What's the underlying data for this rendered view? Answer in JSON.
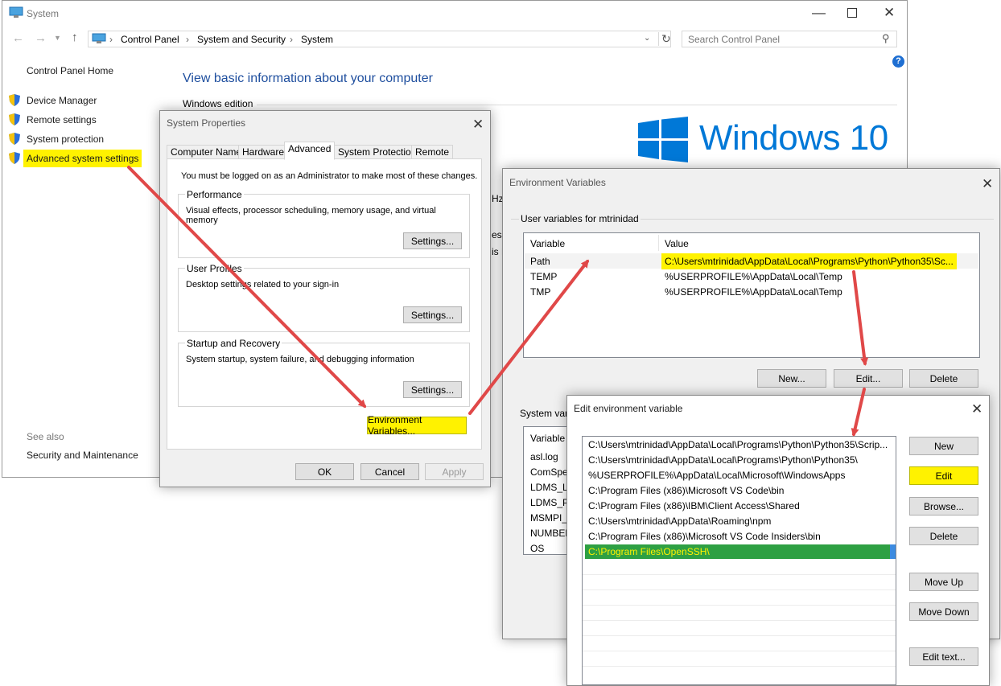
{
  "system_window": {
    "title": "System",
    "address": {
      "crumbs": [
        "Control Panel",
        "System and Security",
        "System"
      ],
      "search_placeholder": "Search Control Panel"
    },
    "sidebar": {
      "home": "Control Panel Home",
      "items": [
        {
          "label": "Device Manager"
        },
        {
          "label": "Remote settings"
        },
        {
          "label": "System protection"
        },
        {
          "label": "Advanced system settings"
        }
      ],
      "see_also": "See also",
      "security": "Security and Maintenance"
    },
    "heading": "View basic information about your computer",
    "windows_edition": "Windows edition",
    "logo_text": "Windows 10",
    "partial_text": [
      "Hz",
      "ess",
      "is D"
    ]
  },
  "system_properties": {
    "title": "System Properties",
    "tabs": [
      "Computer Name",
      "Hardware",
      "Advanced",
      "System Protection",
      "Remote"
    ],
    "admin_note": "You must be logged on as an Administrator to make most of these changes.",
    "performance": {
      "label": "Performance",
      "desc": "Visual effects, processor scheduling, memory usage, and virtual memory",
      "button": "Settings..."
    },
    "user_profiles": {
      "label": "User Profiles",
      "desc": "Desktop settings related to your sign-in",
      "button": "Settings..."
    },
    "startup": {
      "label": "Startup and Recovery",
      "desc": "System startup, system failure, and debugging information",
      "button": "Settings..."
    },
    "env_button": "Environment Variables...",
    "ok": "OK",
    "cancel": "Cancel",
    "apply": "Apply"
  },
  "env_vars": {
    "title": "Environment Variables",
    "user_label": "User variables for mtrinidad",
    "col_variable": "Variable",
    "col_value": "Value",
    "user_rows": [
      {
        "name": "Path",
        "value": "C:\\Users\\mtrinidad\\AppData\\Local\\Programs\\Python\\Python35\\Sc..."
      },
      {
        "name": "TEMP",
        "value": "%USERPROFILE%\\AppData\\Local\\Temp"
      },
      {
        "name": "TMP",
        "value": "%USERPROFILE%\\AppData\\Local\\Temp"
      }
    ],
    "new": "New...",
    "edit": "Edit...",
    "delete": "Delete",
    "system_label": "System vari",
    "sys_col_variable": "Variable",
    "system_rows": [
      "asl.log",
      "ComSpe",
      "LDMS_LO",
      "LDMS_PI",
      "MSMPI_I",
      "NUMBER",
      "OS"
    ]
  },
  "edit_env": {
    "title": "Edit environment variable",
    "entries": [
      "C:\\Users\\mtrinidad\\AppData\\Local\\Programs\\Python\\Python35\\Scrip...",
      "C:\\Users\\mtrinidad\\AppData\\Local\\Programs\\Python\\Python35\\",
      "%USERPROFILE%\\AppData\\Local\\Microsoft\\WindowsApps",
      "C:\\Program Files (x86)\\Microsoft VS Code\\bin",
      "C:\\Program Files (x86)\\IBM\\Client Access\\Shared",
      "C:\\Users\\mtrinidad\\AppData\\Roaming\\npm",
      "C:\\Program Files (x86)\\Microsoft VS Code Insiders\\bin",
      "C:\\Program Files\\OpenSSH\\"
    ],
    "buttons": {
      "new": "New",
      "edit": "Edit",
      "browse": "Browse...",
      "delete": "Delete",
      "move_up": "Move Up",
      "move_down": "Move Down",
      "edit_text": "Edit text..."
    }
  },
  "colors": {
    "highlight": "#fff200",
    "selection": "#2ea043",
    "arrow": "#e04848",
    "windows_blue": "#0078d7",
    "link": "#1a1a1a"
  }
}
